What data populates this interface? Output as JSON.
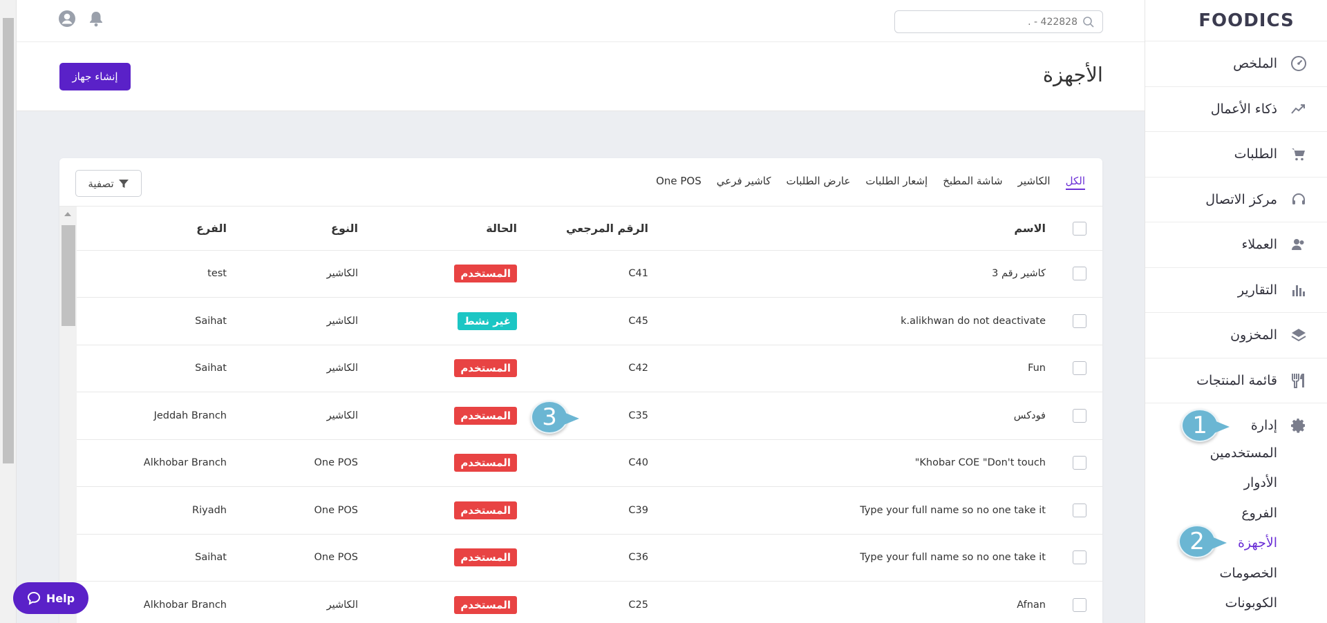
{
  "brand": {
    "logo_text": "FOODICS"
  },
  "sidebar": {
    "items": [
      {
        "label": "الملخص",
        "icon": "dashboard-icon"
      },
      {
        "label": "ذكاء الأعمال",
        "icon": "trend-icon"
      },
      {
        "label": "الطلبات",
        "icon": "cart-icon"
      },
      {
        "label": "مركز الاتصال",
        "icon": "headset-icon"
      },
      {
        "label": "العملاء",
        "icon": "customers-icon"
      },
      {
        "label": "التقارير",
        "icon": "reports-icon"
      },
      {
        "label": "المخزون",
        "icon": "layers-icon"
      },
      {
        "label": "قائمة المنتجات",
        "icon": "cutlery-icon"
      }
    ],
    "management": {
      "label": "إدارة",
      "icon": "gear-icon",
      "sub_items": [
        {
          "label": "المستخدمين"
        },
        {
          "label": "الأدوار"
        },
        {
          "label": "الفروع"
        },
        {
          "label": "الأجهزة",
          "active": true
        },
        {
          "label": "الخصومات"
        },
        {
          "label": "الكوبونات"
        }
      ]
    }
  },
  "topbar": {
    "search_placeholder": "422828 - .",
    "icons": [
      "user-icon",
      "bell-icon"
    ]
  },
  "page": {
    "title": "الأجهزة",
    "create_button": "إنشاء جهاز"
  },
  "tabs": [
    {
      "label": "الكل",
      "active": true
    },
    {
      "label": "الكاشير"
    },
    {
      "label": "شاشة المطبخ"
    },
    {
      "label": "إشعار الطلبات"
    },
    {
      "label": "عارض الطلبات"
    },
    {
      "label": "كاشير فرعي"
    },
    {
      "label": "One POS"
    }
  ],
  "filter_button": "تصفية",
  "table": {
    "headers": {
      "name": "الاسم",
      "ref": "الرقم المرجعي",
      "status": "الحالة",
      "type": "النوع",
      "branch": "الفرع"
    },
    "rows": [
      {
        "name": "كاشير رقم 3",
        "ref": "C41",
        "status": "المستخدم",
        "status_kind": "used",
        "type": "الكاشير",
        "branch": "test"
      },
      {
        "name": "k.alikhwan do not deactivate",
        "ref": "C45",
        "status": "غير نشط",
        "status_kind": "inactive",
        "type": "الكاشير",
        "branch": "Saihat"
      },
      {
        "name": "Fun",
        "ref": "C42",
        "status": "المستخدم",
        "status_kind": "used",
        "type": "الكاشير",
        "branch": "Saihat"
      },
      {
        "name": "فودكس",
        "ref": "C35",
        "status": "المستخدم",
        "status_kind": "used",
        "type": "الكاشير",
        "branch": "Jeddah Branch"
      },
      {
        "name": "Khobar COE \"Don't touch\"",
        "ref": "C40",
        "status": "المستخدم",
        "status_kind": "used",
        "type": "One POS",
        "branch": "Alkhobar Branch"
      },
      {
        "name": "Type your full name so no one take it",
        "ref": "C39",
        "status": "المستخدم",
        "status_kind": "used",
        "type": "One POS",
        "branch": "Riyadh"
      },
      {
        "name": "Type your full name so no one take it",
        "ref": "C36",
        "status": "المستخدم",
        "status_kind": "used",
        "type": "One POS",
        "branch": "Saihat"
      },
      {
        "name": "Afnan",
        "ref": "C25",
        "status": "المستخدم",
        "status_kind": "used",
        "type": "الكاشير",
        "branch": "Alkhobar Branch"
      }
    ]
  },
  "callouts": [
    {
      "number": "1"
    },
    {
      "number": "2"
    },
    {
      "number": "3"
    }
  ],
  "help": {
    "label": "Help"
  },
  "colors": {
    "primary": "#5a21c8",
    "active_link": "#6b2fd6",
    "badge_used": "#e84343",
    "badge_inactive": "#1cc6c4",
    "callout": "#6bb6d3"
  }
}
